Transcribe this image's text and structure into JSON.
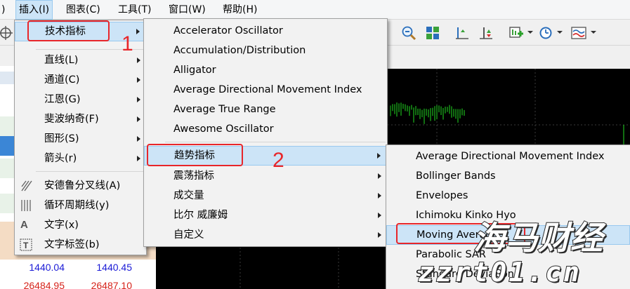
{
  "menubar": {
    "items": [
      {
        "label": ")"
      },
      {
        "label": "插入(I)"
      },
      {
        "label": "图表(C)"
      },
      {
        "label": "工具(T)"
      },
      {
        "label": "窗口(W)"
      },
      {
        "label": "帮助(H)"
      }
    ]
  },
  "insert_menu": {
    "items": [
      {
        "label": "技术指标",
        "has_submenu": true
      },
      {
        "label": "直线(L)",
        "has_submenu": true
      },
      {
        "label": "通道(C)",
        "has_submenu": true
      },
      {
        "label": "江恩(G)",
        "has_submenu": true
      },
      {
        "label": "斐波纳奇(F)",
        "has_submenu": true
      },
      {
        "label": "图形(S)",
        "has_submenu": true
      },
      {
        "label": "箭头(r)",
        "has_submenu": true
      },
      {
        "label": "安德鲁分叉线(A)",
        "icon": "andrews-pitchfork-icon"
      },
      {
        "label": "循环周期线(y)",
        "icon": "cycle-lines-icon"
      },
      {
        "label": "文字(x)",
        "icon": "text-icon"
      },
      {
        "label": "文字标签(b)",
        "icon": "text-label-icon"
      }
    ]
  },
  "indicators_menu": {
    "items": [
      {
        "label": "Accelerator Oscillator"
      },
      {
        "label": "Accumulation/Distribution"
      },
      {
        "label": "Alligator"
      },
      {
        "label": "Average Directional Movement Index"
      },
      {
        "label": "Average True Range"
      },
      {
        "label": "Awesome Oscillator"
      },
      {
        "label": "趋势指标",
        "has_submenu": true
      },
      {
        "label": "震荡指标",
        "has_submenu": true
      },
      {
        "label": "成交量",
        "has_submenu": true
      },
      {
        "label": "比尔 威廉姆",
        "has_submenu": true
      },
      {
        "label": "自定义",
        "has_submenu": true
      }
    ]
  },
  "trend_menu": {
    "items": [
      {
        "label": "Average Directional Movement Index"
      },
      {
        "label": "Bollinger Bands"
      },
      {
        "label": "Envelopes"
      },
      {
        "label": "Ichimoku Kinko Hyo"
      },
      {
        "label": "Moving Average"
      },
      {
        "label": "Parabolic SAR"
      },
      {
        "label": "Standard Deviation"
      }
    ]
  },
  "annotations": {
    "step1": "1",
    "step2": "2"
  },
  "quotes": [
    {
      "bid": "1440.04",
      "ask": "1440.45",
      "color": "#1a1ad6"
    },
    {
      "bid": "26484.95",
      "ask": "26487.10",
      "color": "#d6231a"
    }
  ],
  "watermark": {
    "title": "海马财经",
    "url": "zzrt01.cn"
  },
  "colors": {
    "highlight": "#cce4f7",
    "annotation_red": "#e8262a",
    "chart_bg": "#000000",
    "candle": "#22dd22"
  }
}
